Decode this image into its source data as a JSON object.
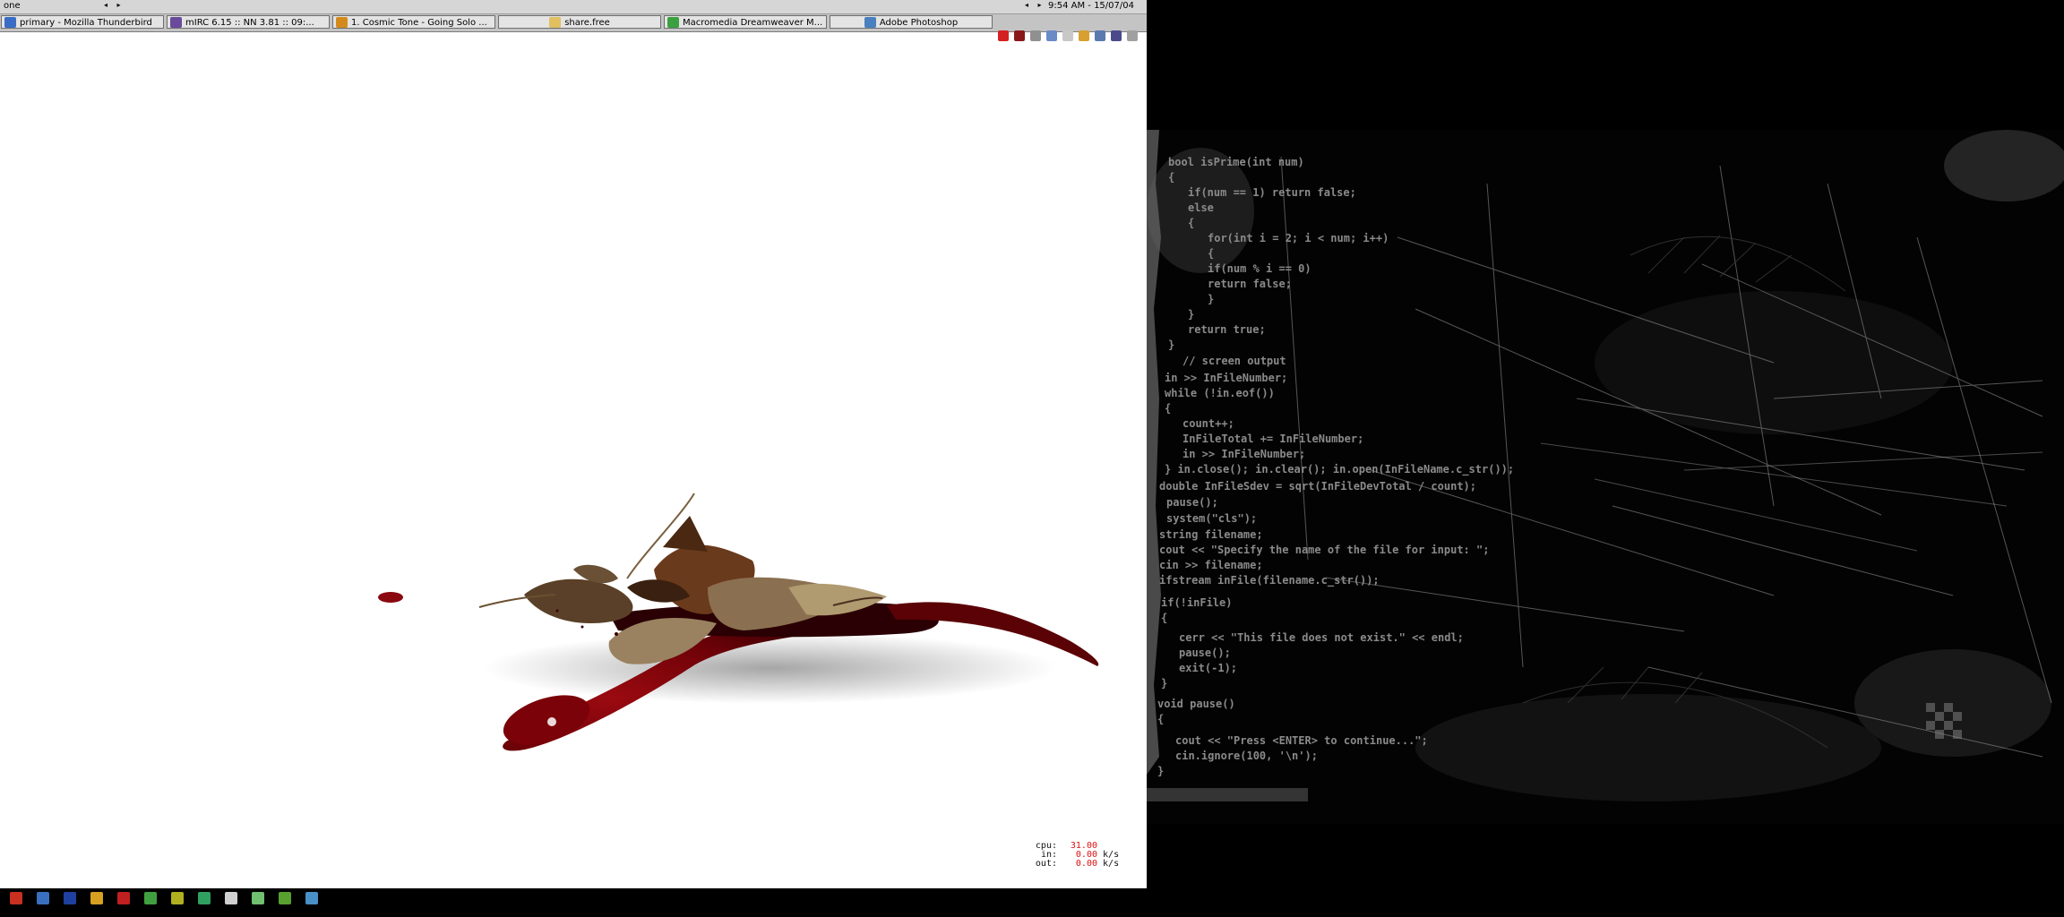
{
  "left_screen": {
    "workspace_name": "one",
    "clock": "9:54 AM - 15/07/04",
    "nav_arrows": "◂ ▸",
    "taskbar": [
      {
        "label": "primary - Mozilla Thunderbird",
        "icon": "thunderbird-icon",
        "icon_color": "#3a6cc6"
      },
      {
        "label": "mIRC 6.15 :: NN 3.81 :: 09:...",
        "icon": "mirc-icon",
        "icon_color": "#6a4a9a"
      },
      {
        "label": "1. Cosmic Tone - Going Solo ...",
        "icon": "winamp-icon",
        "icon_color": "#d48a1a"
      },
      {
        "label": "share.free",
        "icon": "folder-icon",
        "icon_color": "#e2c060"
      },
      {
        "label": "Macromedia Dreamweaver M...",
        "icon": "dreamweaver-icon",
        "icon_color": "#3aa040"
      },
      {
        "label": "Adobe Photoshop",
        "icon": "photoshop-icon",
        "icon_color": "#4a80c0"
      }
    ],
    "tray_icons": [
      "tray-icon-1",
      "tray-icon-2",
      "tray-icon-3",
      "tray-icon-4",
      "tray-icon-5",
      "tray-icon-6",
      "tray-icon-7",
      "tray-icon-8",
      "tray-icon-9"
    ],
    "stats": {
      "cpu_label": "cpu:",
      "cpu_value": "31.00",
      "cpu_unit": "",
      "in_label": "in:",
      "in_value": "0.00",
      "in_unit": "k/s",
      "out_label": "out:",
      "out_value": "0.00",
      "out_unit": "k/s"
    },
    "quick_launch": [
      {
        "icon": "quicklaunch-icon-1",
        "color": "#c83020"
      },
      {
        "icon": "quicklaunch-icon-2",
        "color": "#3a70c0"
      },
      {
        "icon": "quicklaunch-icon-3",
        "color": "#2040a0"
      },
      {
        "icon": "quicklaunch-icon-4",
        "color": "#d8a020"
      },
      {
        "icon": "quicklaunch-icon-5",
        "color": "#c02020"
      },
      {
        "icon": "quicklaunch-icon-6",
        "color": "#40a040"
      },
      {
        "icon": "quicklaunch-icon-7",
        "color": "#b0b020"
      },
      {
        "icon": "quicklaunch-icon-8",
        "color": "#30a060"
      },
      {
        "icon": "quicklaunch-icon-9",
        "color": "#d0d0d0"
      },
      {
        "icon": "quicklaunch-icon-10",
        "color": "#70c070"
      },
      {
        "icon": "quicklaunch-icon-11",
        "color": "#58a030"
      },
      {
        "icon": "quicklaunch-icon-12",
        "color": "#4a90c8"
      }
    ]
  },
  "right_screen": {
    "code_lines": [
      "bool isPrime(int num)",
      "{",
      "  if(num == 1) return false;",
      "  else",
      "  {",
      "    for(int i = 2; i < num; i++)",
      "    {",
      "      if(num % i == 0)",
      "        return false;",
      "    }",
      "  }",
      "  return true;",
      "}",
      "// screen output",
      "in >> InFileNumber;",
      "while (!in.eof())",
      "{",
      "  count++;",
      "  InFileTotal += InFileNumber;",
      "  in >> InFileNumber;",
      "}  in.close(); in.clear(); in.open(InFileName.c_str());",
      "double InFileSdev = sqrt(InFileDevTotal / count);",
      "pause();",
      "system(\"cls\");",
      "string filename;",
      "cout << \"Specify the name of the file for input: \";",
      "cin >> filename;",
      "ifstream inFile(filename.c_str());",
      "if(!inFile)",
      "{",
      "  cerr << \"This file does not exist.\" << endl;",
      "  pause();",
      "  exit(-1);",
      "}",
      "void pause()",
      "{",
      "  cout << \"Press <ENTER> to continue...\";",
      "  cin.ignore(100, '\\n');",
      "}"
    ]
  }
}
